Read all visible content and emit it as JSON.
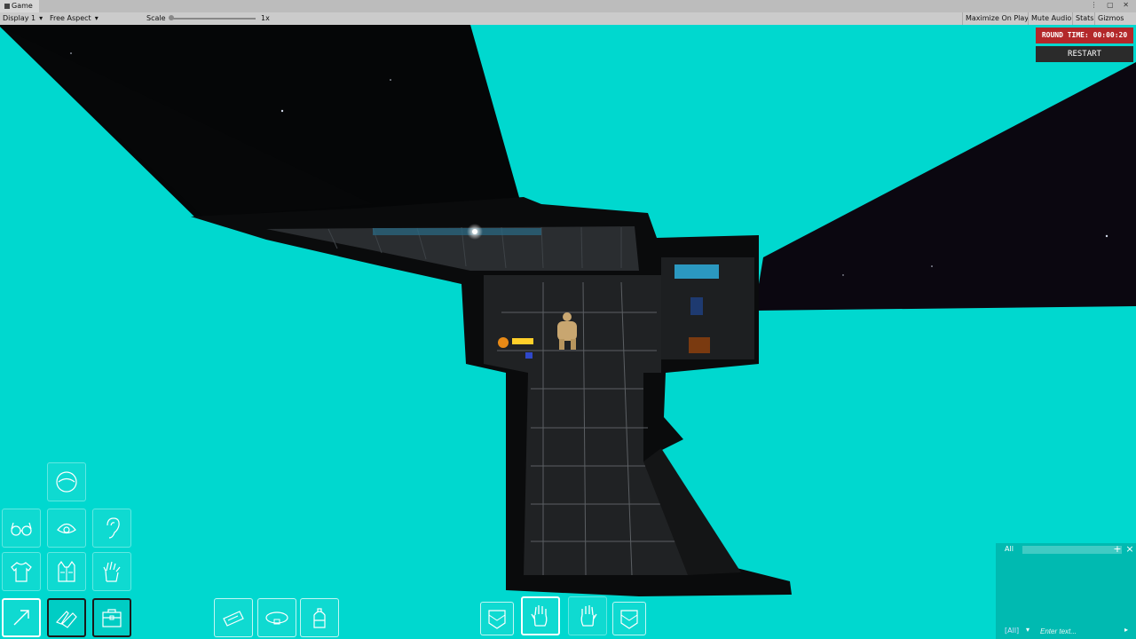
{
  "editor": {
    "tab_title": "Game",
    "display": "Display 1",
    "aspect": "Free Aspect",
    "scale_label": "Scale",
    "scale_value": "1x",
    "maximize": "Maximize On Play",
    "mute": "Mute Audio",
    "stats": "Stats",
    "gizmos": "Gizmos"
  },
  "hud": {
    "round_time": "ROUND TIME: 00:00:20",
    "restart": "RESTART"
  },
  "equipment_slots": [
    {
      "name": "head-slot",
      "icon": "helmet-icon"
    },
    {
      "name": "eyes-slot",
      "icon": "glasses-icon"
    },
    {
      "name": "mask-slot",
      "icon": "mask-icon"
    },
    {
      "name": "ears-slot",
      "icon": "ear-icon"
    },
    {
      "name": "uniform-slot",
      "icon": "shirt-icon"
    },
    {
      "name": "suit-slot",
      "icon": "vest-icon"
    },
    {
      "name": "gloves-slot",
      "icon": "glove-icon"
    },
    {
      "name": "toggle-inventory-slot",
      "icon": "arrow-icon"
    },
    {
      "name": "shoes-slot",
      "icon": "shoe-icon"
    },
    {
      "name": "backpack-slot",
      "icon": "bag-icon"
    },
    {
      "name": "id-slot",
      "icon": "id-card-icon"
    },
    {
      "name": "belt-slot",
      "icon": "belt-icon"
    },
    {
      "name": "back-slot",
      "icon": "backpack-icon"
    },
    {
      "name": "left-pocket-slot",
      "icon": "pocket-icon"
    },
    {
      "name": "left-hand-slot",
      "icon": "hand-icon"
    },
    {
      "name": "right-hand-slot",
      "icon": "hand-icon"
    },
    {
      "name": "right-pocket-slot",
      "icon": "pocket-icon"
    }
  ],
  "chat": {
    "tab": "All",
    "channel": "[All]",
    "placeholder": "Enter text..."
  },
  "colors": {
    "space_cyan": "#00d8cf",
    "round_red": "#b3282a",
    "restart_dark": "#2b2b2b"
  }
}
